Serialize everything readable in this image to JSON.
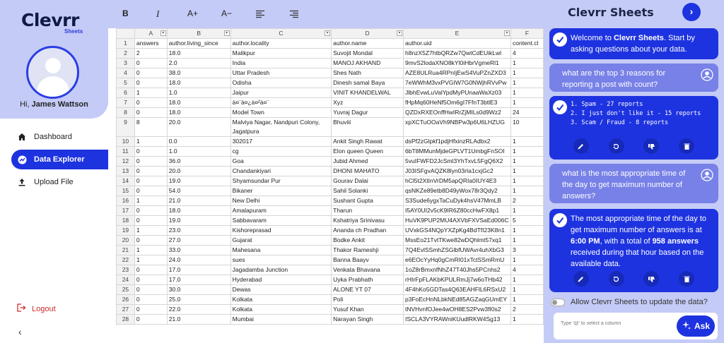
{
  "brand": {
    "name": "Clevrr",
    "sub": "Sheets"
  },
  "user": {
    "greeting": "Hi, ",
    "name": "James Wattson"
  },
  "nav": [
    {
      "label": "Dashboard",
      "icon": "home-icon"
    },
    {
      "label": "Data Explorer",
      "icon": "chart-icon",
      "active": true
    },
    {
      "label": "Upload File",
      "icon": "upload-icon"
    }
  ],
  "logout_label": "Logout",
  "toolbar": {
    "bold": "B",
    "italic": "I",
    "font_up": "A+",
    "font_down": "A−"
  },
  "sheet": {
    "col_letters": [
      "A",
      "B",
      "C",
      "D",
      "E",
      "F"
    ],
    "headers": [
      "answers",
      "author.living_since",
      "author.locality",
      "author.name",
      "author.uid",
      "content.cl"
    ],
    "rows": [
      [
        "2",
        "18.0",
        "Malikpur",
        "Suvojit Mondal",
        "h8nzX5Z7htbQRZw7QwtCdEUikLwl",
        "4"
      ],
      [
        "0",
        "2.0",
        "India",
        "MANOJ AKHAND",
        "9mvS2lodaXNO8kYl0iHbrVgmeRl1",
        "1"
      ],
      [
        "0",
        "38.0",
        "Uttar Pradesh",
        "Shes Nath",
        "AZE8ULRua4RPnIjEwS4VuPZnZXD3",
        "1"
      ],
      [
        "0",
        "18.0",
        "Odisha",
        "Dinesh samal Baya",
        "7eWWhM3vxPVGIW7G0NWjhRVvPw",
        "1"
      ],
      [
        "1",
        "1.0",
        "Jaipur",
        "VINIT KHANDELWAL",
        "JlbhEvwLuValYpdMyPUnaaWaXz03",
        "1"
      ],
      [
        "0",
        "18.0",
        "à¤¨à¤¿à¤²à¤¨",
        "Xyz",
        "fHpMq60HeNf5Om6gI7FfnT3btlE3",
        "1"
      ],
      [
        "0",
        "18.0",
        "Model Town",
        "Yuvraj Dagur",
        "QZDxRXEOnffHwIRrZjMILs0d9Wz2",
        "24"
      ],
      [
        "8",
        "20.0",
        "Malviya Nagar, Nandpuri Colony, Jagatpura",
        "Bhuviii",
        "xpXCTuOOaVh9NBPw3p6U6LHZUG",
        "10"
      ],
      [
        "1",
        "0.0",
        "302017",
        "Ankit Singh Rawat",
        "dsPf2zGlpkf1pdjHfxinzRLAdbx2",
        "1"
      ],
      [
        "0",
        "1.0",
        "cg",
        "Elon queen Queen",
        "6bT8MMunMjdeGPLVT1UmbgFnSOI",
        "1"
      ],
      [
        "0",
        "36.0",
        "Goa",
        "Jubid Ahmed",
        "5vuIFWFD2JcSml3YhTxvL5FgQ6X2",
        "1"
      ],
      [
        "0",
        "20.0",
        "Chandankiyari",
        "DHONI MAHATO",
        "J03ISFgvAQZK8lyn03rIa1cxjGc2",
        "1"
      ],
      [
        "0",
        "19.0",
        "Shyamsundar Pur",
        "Gourav Dalai",
        "hCl5t2XtInVrDM5apQRIa0IUY4E3",
        "1"
      ],
      [
        "0",
        "54.0",
        "Bikaner",
        "Sahil Solanki",
        "qsNKZe89etb8D49yWox78r3Qdy2",
        "1"
      ],
      [
        "1",
        "21.0",
        "New Delhi",
        "Sushant Gupta",
        "S3Sude6ygxTaCuDyk4hsV47MmLB",
        "2"
      ],
      [
        "0",
        "18.0",
        "Amalapuram",
        "Tharun",
        "I5AY0UI2v5cK9IR6Z80ccHwFX8p1",
        "1"
      ],
      [
        "0",
        "19.0",
        "Sabbavaram",
        "Kshatriya Srinivasu",
        "HuVK9PUP2MU4AXVbFXVSaEd006C",
        "5"
      ],
      [
        "1",
        "23.0",
        "Kishoreprasad",
        "Ananda ch Pradhan",
        "UVxkGS4NQpYXZpKg4BdTfI23K8n1",
        "1"
      ],
      [
        "0",
        "27.0",
        "Gujarat",
        "Bodke Ankit",
        "MssEo21TvtTKwe82wDQhlmt57xq1",
        "1"
      ],
      [
        "1",
        "33.0",
        "Mahesana",
        "Thakor Rameshji",
        "7Q4EvlSSmhZSGlbfUWAvr4uhXbG3",
        "3"
      ],
      [
        "1",
        "24.0",
        "sues",
        "Banna Baayv",
        "e6EOcYyHq0gCmRI01xTctSSmRmU",
        "1"
      ],
      [
        "0",
        "17.0",
        "Jagadamba Junction",
        "Venkata Bhavana",
        "1oZ8rBmxnfNhZ47T40Jhs5PCnhs2",
        "4"
      ],
      [
        "0",
        "17.0",
        "Hyderabad",
        "Uyka Prabhath",
        "rHIrFpFLAKbKPULRmJj7w6oTHb42",
        "1"
      ],
      [
        "0",
        "30.0",
        "Dewas",
        "ALONE YT 07",
        "4F4hKo5GDTas4Q63EAHFlL6RSxU2",
        "1"
      ],
      [
        "0",
        "25.0",
        "Kolkata",
        "Poli",
        "p3FoEcHnNLbkNEd85AGZaqGUmEY",
        "1"
      ],
      [
        "0",
        "22.0",
        "Kolkata",
        "Yusuf Khan",
        "tNVHvnfOJee4wOH8ES2Pvw3fI0s2",
        "2"
      ],
      [
        "0",
        "21.0",
        "Mumbai",
        "Narayan Singh",
        "ISCLA3VYRAWniKUudlRKW4Sg13",
        "1"
      ]
    ]
  },
  "chat": {
    "title": "Clevrr Sheets",
    "welcome_pre": "Welcome to ",
    "welcome_brand": "Clevrr Sheets",
    "welcome_post": ". Start by asking questions about your data.",
    "q1": "what are the top 3 reasons for reporting a post with count?",
    "a1_lines": [
      "1. Spam - 27 reports",
      "2. I just don't like it - 15 reports",
      "3. Scam / Fraud - 8 reports"
    ],
    "q2": "what is the most appropriate time of the day to get maximum number of answers?",
    "a2_pre": "The most appropriate time of the day to get maximum number of answers is at ",
    "a2_time": "6:00 PM",
    "a2_mid": ", with a total of ",
    "a2_count": "958 answers",
    "a2_post": " received during that hour based on the available data.",
    "toggle_label": "Allow Clevrr Sheets to update the data?",
    "input_placeholder": "Type '@' to select a column",
    "ask_label": "Ask"
  },
  "colors": {
    "accent": "#1e33e0",
    "panel": "#c5cbf7",
    "user_bubble": "#7781e7",
    "logout": "#d02b2b"
  }
}
